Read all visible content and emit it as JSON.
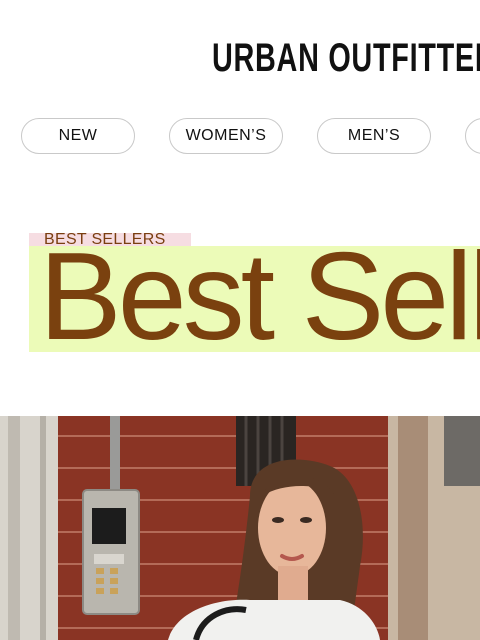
{
  "brand": {
    "name": "URBAN OUTFITTERS"
  },
  "nav": {
    "items": [
      {
        "label": "NEW"
      },
      {
        "label": "WOMEN’S"
      },
      {
        "label": "MEN’S"
      },
      {
        "label": ""
      }
    ]
  },
  "section": {
    "eyebrow": "BEST SELLERS",
    "headline": "Best Sellers"
  },
  "colors": {
    "eyebrow_bg": "#f6dde2",
    "banner_bg": "#ecfbb8",
    "banner_text": "#7a410f"
  },
  "hero": {
    "image": "street-photo-woman-brick-wall"
  }
}
